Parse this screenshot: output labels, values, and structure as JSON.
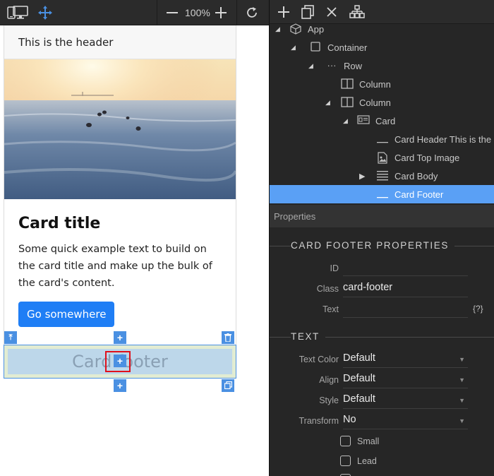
{
  "left_toolbar": {
    "zoom_level": "100%",
    "icons": [
      "mobile-icon",
      "desktop-icon",
      "move-icon",
      "zoom-out-icon",
      "zoom-in-icon",
      "refresh-icon"
    ]
  },
  "preview": {
    "card_header": "This is the header",
    "card_title": "Card title",
    "card_text": "Some quick example text to build on the card title and make up the bulk of the card's content.",
    "button_label": "Go somewhere",
    "card_footer": "Card footer"
  },
  "right_toolbar": {
    "icons": [
      "add-icon",
      "duplicate-icon",
      "close-icon",
      "hierarchy-icon"
    ]
  },
  "tree": {
    "items": [
      {
        "label": "App",
        "icon": "cube-icon",
        "expanded": true
      },
      {
        "label": "Container",
        "icon": "square-icon",
        "expanded": true
      },
      {
        "label": "Row",
        "icon": "ellipsis-icon",
        "expanded": true
      },
      {
        "label": "Column",
        "icon": "column-icon",
        "expanded": false
      },
      {
        "label": "Column",
        "icon": "column-icon",
        "expanded": true
      },
      {
        "label": "Card",
        "icon": "card-icon",
        "expanded": true
      },
      {
        "label": "Card Header This is the h",
        "icon": "underline-icon"
      },
      {
        "label": "Card Top Image",
        "icon": "image-icon"
      },
      {
        "label": "Card Body",
        "icon": "lines-icon",
        "expanded": false
      },
      {
        "label": "Card Footer",
        "icon": "underline-icon",
        "selected": true
      }
    ]
  },
  "properties": {
    "panel_title": "Properties",
    "section_title": "CARD FOOTER PROPERTIES",
    "id_label": "ID",
    "id_value": "",
    "class_label": "Class",
    "class_value": "card-footer",
    "text_label": "Text",
    "text_value": "",
    "text_button": "{?}"
  },
  "text_section": {
    "title": "TEXT",
    "text_color_label": "Text Color",
    "text_color_value": "Default",
    "align_label": "Align",
    "align_value": "Default",
    "style_label": "Style",
    "style_value": "Default",
    "transform_label": "Transform",
    "transform_value": "No",
    "small_label": "Small",
    "lead_label": "Lead"
  },
  "colors": {
    "accent": "#4a90e2",
    "selected_row": "#5aa0f5",
    "highlight": "#e0101b",
    "button": "#1f7ef5"
  }
}
